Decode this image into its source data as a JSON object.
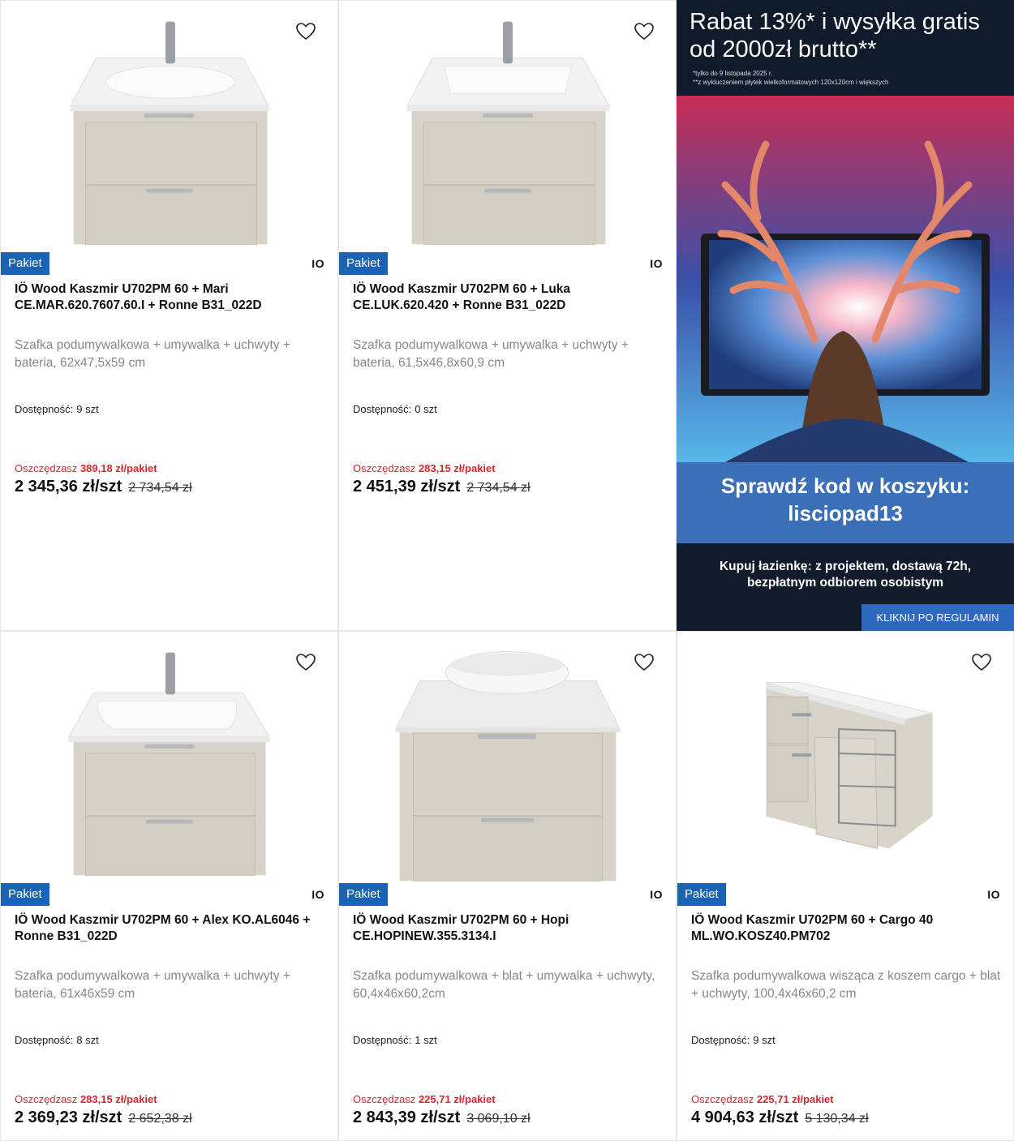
{
  "products": [
    {
      "badge": "Pakiet",
      "brand": "IO",
      "title": "IÖ Wood Kaszmir U702PM 60 + Mari CE.MAR.620.7607.60.I + Ronne B31_022D",
      "description": "Szafka podumywalkowa + umywalka + uchwyty + bateria, 62x47,5x59 cm",
      "availability_label": "Dostępność:",
      "availability": "9 szt",
      "save_label": "Oszczędzasz",
      "save_value": "389,18 zł/pakiet",
      "price": "2 345,36 zł/szt",
      "old_price": "2 734,54 zł",
      "image": "vanity-with-sink-and-faucet"
    },
    {
      "badge": "Pakiet",
      "brand": "IO",
      "title": "IÖ Wood Kaszmir U702PM 60 + Luka CE.LUK.620.420 + Ronne B31_022D",
      "description": "Szafka podumywalkowa + umywalka + uchwyty + bateria, 61,5x46,8x60,9 cm",
      "availability_label": "Dostępność:",
      "availability": "0 szt",
      "save_label": "Oszczędzasz",
      "save_value": "283,15 zł/pakiet",
      "price": "2 451,39 zł/szt",
      "old_price": "2 734,54 zł",
      "image": "vanity-with-sink-and-faucet"
    },
    {
      "badge": "Pakiet",
      "brand": "IO",
      "title": "IÖ Wood Kaszmir U702PM 60 + Alex KO.AL6046 + Ronne B31_022D",
      "description": "Szafka podumywalkowa + umywalka + uchwyty + bateria, 61x46x59 cm",
      "availability_label": "Dostępność:",
      "availability": "8 szt",
      "save_label": "Oszczędzasz",
      "save_value": "283,15 zł/pakiet",
      "price": "2 369,23 zł/szt",
      "old_price": "2 652,38 zł",
      "image": "vanity-with-sink-and-faucet"
    },
    {
      "badge": "Pakiet",
      "brand": "IO",
      "title": "IÖ Wood Kaszmir U702PM 60 + Hopi CE.HOPINEW.355.3134.I",
      "description": "Szafka podumywalkowa + blat + umywalka + uchwyty, 60,4x46x60,2cm",
      "availability_label": "Dostępność:",
      "availability": "1 szt",
      "save_label": "Oszczędzasz",
      "save_value": "225,71 zł/pakiet",
      "price": "2 843,39 zł/szt",
      "old_price": "3 069,10 zł",
      "image": "vanity-with-countertop-bowl"
    },
    {
      "badge": "Pakiet",
      "brand": "IO",
      "title": "IÖ Wood Kaszmir U702PM 60 + Cargo 40 ML.WO.KOSZ40.PM702",
      "description": "Szafka podumywalkowa wisząca z koszem cargo + blat + uchwyty, 100,4x46x60,2 cm",
      "availability_label": "Dostępność:",
      "availability": "9 szt",
      "save_label": "Oszczędzasz",
      "save_value": "225,71 zł/pakiet",
      "price": "4 904,63 zł/szt",
      "old_price": "5 130,34 zł",
      "image": "cabinet-with-cargo-basket"
    }
  ],
  "banner": {
    "headline": "Rabat 13%* i wysyłka gratis od 2000zł brutto**",
    "note1": "*tylko do 9 listopada 2025 r.",
    "note2": "**z wykluczeniem płytek wielkoformatowych 120x120cm i większych",
    "code_line1": "Sprawdź kod w koszyku:",
    "code_line2": "lisciopad13",
    "tagline1": "Kupuj łazienkę: z projektem, dostawą 72h,",
    "tagline2": "bezpłatnym odbiorem osobistym",
    "cta": "KLIKNIJ PO REGULAMIN",
    "image": "deer-antlers-in-front-of-monitor"
  },
  "icons": {
    "favorite": "heart-icon"
  },
  "colors": {
    "badge": "#1b64b3",
    "save": "#d9262e",
    "banner_blue": "#3b6fb8",
    "banner_dark": "#0f1a2b"
  }
}
